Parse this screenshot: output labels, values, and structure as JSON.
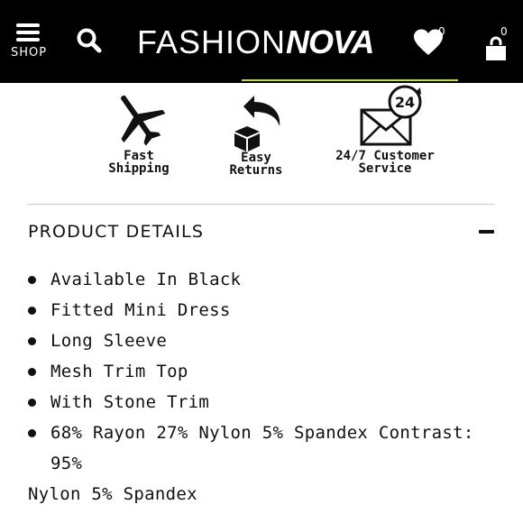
{
  "header": {
    "menu_label": "SHOP",
    "logo_light": "FASHION",
    "logo_bold": "NOVA",
    "wishlist_count": "0",
    "cart_count": "0",
    "accent_color": "#b7e44a"
  },
  "perks": [
    {
      "icon": "airplane-icon",
      "label_line1": "Fast",
      "label_line2": "Shipping"
    },
    {
      "icon": "return-box-icon",
      "label_line1": "Easy",
      "label_line2": "Returns"
    },
    {
      "icon": "envelope-24-icon",
      "badge": "24",
      "label_line1": "24/7 Customer",
      "label_line2": "Service"
    }
  ],
  "details": {
    "title": "PRODUCT DETAILS",
    "items": [
      "Available In Black",
      "Fitted Mini Dress",
      "Long Sleeve",
      "Mesh Trim Top",
      "With Stone Trim"
    ],
    "last_item_line1": "68% Rayon 27% Nylon 5% Spandex Contrast: 95%",
    "last_item_line2": "Nylon 5% Spandex"
  }
}
